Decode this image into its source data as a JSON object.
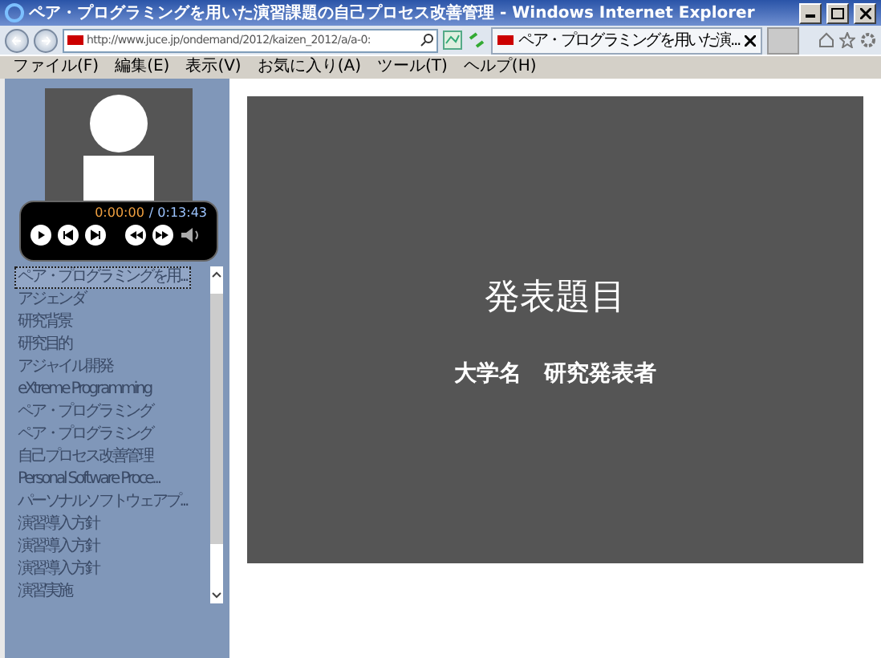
{
  "window": {
    "title": "ペア・プログラミングを用いた演習課題の自己プロセス改善管理 - Windows Internet Explorer"
  },
  "address_bar": {
    "value": "http://www.juce.jp/ondemand/2012/kaizen_2012/a/a-0:"
  },
  "tab": {
    "title": "ペア・プログラミングを用いた演..."
  },
  "menu": [
    "ファイル(F)",
    "編集(E)",
    "表示(V)",
    "お気に入り(A)",
    "ツール(T)",
    "ヘルプ(H)"
  ],
  "player": {
    "elapsed": "0:00:00",
    "total": "/ 0:13:43"
  },
  "chapters": [
    {
      "label": "ペア・プログラミングを用...",
      "selected": true
    },
    {
      "label": "アジェンダ",
      "selected": false
    },
    {
      "label": "研究背景",
      "selected": false
    },
    {
      "label": "研究目的",
      "selected": false
    },
    {
      "label": "アジャイル開発",
      "selected": false
    },
    {
      "label": "eXtreme Programming",
      "selected": false
    },
    {
      "label": "ペア・プログラミング",
      "selected": false
    },
    {
      "label": "ペア・プログラミング",
      "selected": false
    },
    {
      "label": "自己プロセス改善管理",
      "selected": false
    },
    {
      "label": "Personal Software Proce...",
      "selected": false
    },
    {
      "label": "パーソナルソフトウェアプ...",
      "selected": false
    },
    {
      "label": "演習導入方針",
      "selected": false
    },
    {
      "label": "演習導入方針",
      "selected": false
    },
    {
      "label": "演習導入方針",
      "selected": false
    },
    {
      "label": "演習実施",
      "selected": false
    }
  ],
  "slide": {
    "title": "発表題目",
    "affiliation": "大学名",
    "presenter": "研究発表者"
  }
}
